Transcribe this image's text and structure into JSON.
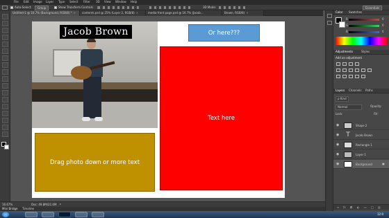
{
  "menubar": {
    "items": [
      "File",
      "Edit",
      "Image",
      "Layer",
      "Type",
      "Select",
      "Filter",
      "3D",
      "View",
      "Window",
      "Help"
    ]
  },
  "options_bar": {
    "auto_select_label": "Auto-Select:",
    "group_value": "Group",
    "show_transform_label": "Show Transform Controls",
    "mode_3d_label": "3D Mode:",
    "workspace_value": "Essentials"
  },
  "tabs": [
    {
      "label": "Untitled-1 @ 16.7% (Background, RGB/8) *",
      "active": true
    },
    {
      "label": "contents.psd @ 25% (Layer 2, RGB/8)",
      "active": false
    },
    {
      "label": "media front page.psd @ 16.7% (Jacob...",
      "active": false
    },
    {
      "label": "Brown, RGB/8)",
      "active": false
    }
  ],
  "canvas": {
    "name_label": "Jacob Brown",
    "drag_box_text": "Drag photo down or more text",
    "or_here_text": "Or here???",
    "red_box_text": "Text here"
  },
  "status": {
    "zoom": "16.67%",
    "doc_size": "Doc: 49.8M/21.6M"
  },
  "bottom_tabs": [
    "Mini Bridge",
    "Timeline"
  ],
  "color_panel": {
    "tabs": [
      "Color",
      "Swatches"
    ],
    "slider_labels": [
      "R",
      "G",
      "B"
    ],
    "slider_values": [
      "0",
      "0",
      "0"
    ],
    "colors": {
      "r": "#e23b3b",
      "g": "#3bd35c",
      "b": "#3b6ae2"
    }
  },
  "adjustments_panel": {
    "tabs": [
      "Adjustments",
      "Styles"
    ],
    "add_label": "Add an adjustment"
  },
  "layers_panel": {
    "tabs": [
      "Layers",
      "Channels",
      "Paths"
    ],
    "kind_label": "Kind",
    "blend_mode": "Normal",
    "opacity_label": "Opacity:",
    "lock_label": "Lock:",
    "fill_label": "Fill:",
    "layers": [
      {
        "name": "Shape 2",
        "type": "shape"
      },
      {
        "name": "Jacob Brown",
        "type": "text"
      },
      {
        "name": "Rectangle 1",
        "type": "shape"
      },
      {
        "name": "Layer 1",
        "type": "pixel"
      },
      {
        "name": "Background",
        "type": "background"
      }
    ]
  },
  "taskbar": {
    "clock": "12:0"
  }
}
